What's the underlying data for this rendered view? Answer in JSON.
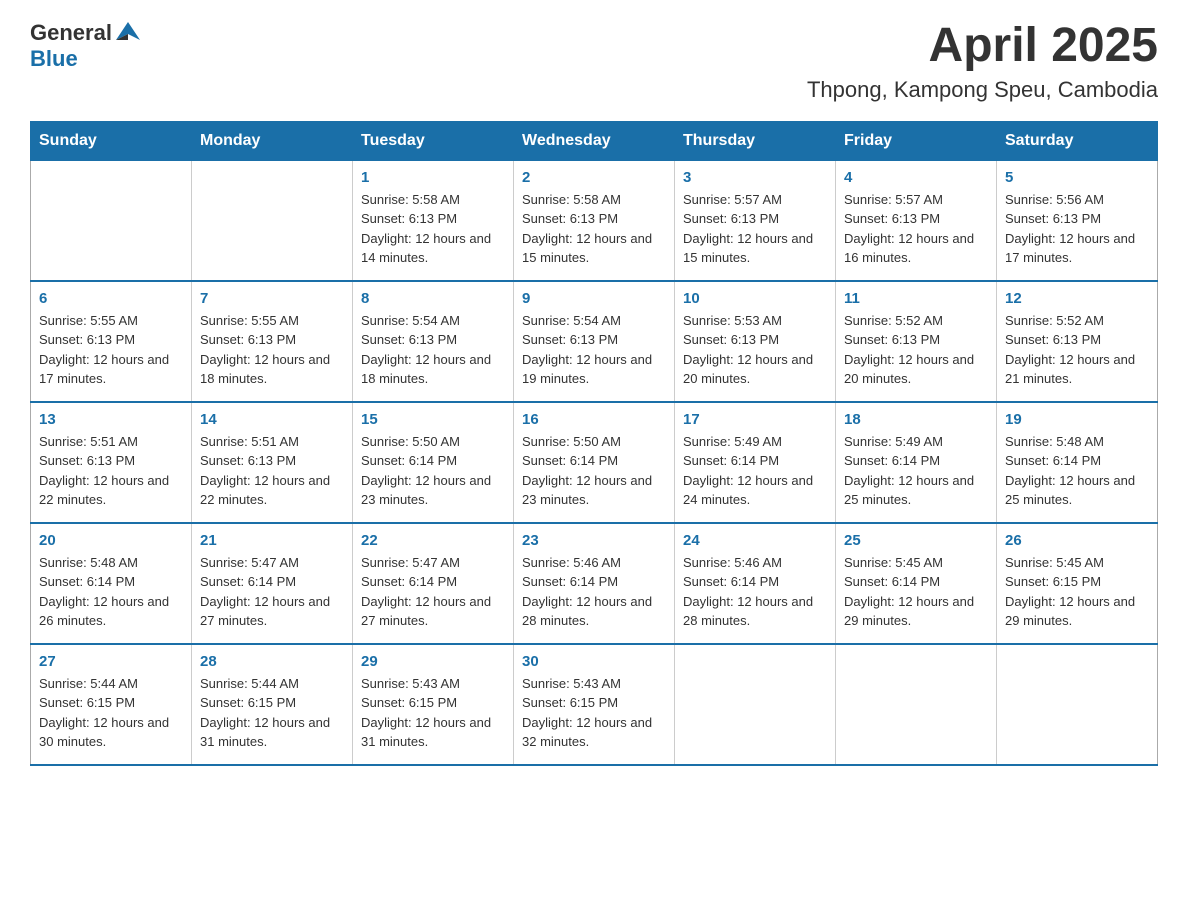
{
  "header": {
    "logo_general": "General",
    "logo_blue": "Blue",
    "title": "April 2025",
    "subtitle": "Thpong, Kampong Speu, Cambodia"
  },
  "calendar": {
    "days_of_week": [
      "Sunday",
      "Monday",
      "Tuesday",
      "Wednesday",
      "Thursday",
      "Friday",
      "Saturday"
    ],
    "weeks": [
      [
        {
          "day": "",
          "sunrise": "",
          "sunset": "",
          "daylight": ""
        },
        {
          "day": "",
          "sunrise": "",
          "sunset": "",
          "daylight": ""
        },
        {
          "day": "1",
          "sunrise": "Sunrise: 5:58 AM",
          "sunset": "Sunset: 6:13 PM",
          "daylight": "Daylight: 12 hours and 14 minutes."
        },
        {
          "day": "2",
          "sunrise": "Sunrise: 5:58 AM",
          "sunset": "Sunset: 6:13 PM",
          "daylight": "Daylight: 12 hours and 15 minutes."
        },
        {
          "day": "3",
          "sunrise": "Sunrise: 5:57 AM",
          "sunset": "Sunset: 6:13 PM",
          "daylight": "Daylight: 12 hours and 15 minutes."
        },
        {
          "day": "4",
          "sunrise": "Sunrise: 5:57 AM",
          "sunset": "Sunset: 6:13 PM",
          "daylight": "Daylight: 12 hours and 16 minutes."
        },
        {
          "day": "5",
          "sunrise": "Sunrise: 5:56 AM",
          "sunset": "Sunset: 6:13 PM",
          "daylight": "Daylight: 12 hours and 17 minutes."
        }
      ],
      [
        {
          "day": "6",
          "sunrise": "Sunrise: 5:55 AM",
          "sunset": "Sunset: 6:13 PM",
          "daylight": "Daylight: 12 hours and 17 minutes."
        },
        {
          "day": "7",
          "sunrise": "Sunrise: 5:55 AM",
          "sunset": "Sunset: 6:13 PM",
          "daylight": "Daylight: 12 hours and 18 minutes."
        },
        {
          "day": "8",
          "sunrise": "Sunrise: 5:54 AM",
          "sunset": "Sunset: 6:13 PM",
          "daylight": "Daylight: 12 hours and 18 minutes."
        },
        {
          "day": "9",
          "sunrise": "Sunrise: 5:54 AM",
          "sunset": "Sunset: 6:13 PM",
          "daylight": "Daylight: 12 hours and 19 minutes."
        },
        {
          "day": "10",
          "sunrise": "Sunrise: 5:53 AM",
          "sunset": "Sunset: 6:13 PM",
          "daylight": "Daylight: 12 hours and 20 minutes."
        },
        {
          "day": "11",
          "sunrise": "Sunrise: 5:52 AM",
          "sunset": "Sunset: 6:13 PM",
          "daylight": "Daylight: 12 hours and 20 minutes."
        },
        {
          "day": "12",
          "sunrise": "Sunrise: 5:52 AM",
          "sunset": "Sunset: 6:13 PM",
          "daylight": "Daylight: 12 hours and 21 minutes."
        }
      ],
      [
        {
          "day": "13",
          "sunrise": "Sunrise: 5:51 AM",
          "sunset": "Sunset: 6:13 PM",
          "daylight": "Daylight: 12 hours and 22 minutes."
        },
        {
          "day": "14",
          "sunrise": "Sunrise: 5:51 AM",
          "sunset": "Sunset: 6:13 PM",
          "daylight": "Daylight: 12 hours and 22 minutes."
        },
        {
          "day": "15",
          "sunrise": "Sunrise: 5:50 AM",
          "sunset": "Sunset: 6:14 PM",
          "daylight": "Daylight: 12 hours and 23 minutes."
        },
        {
          "day": "16",
          "sunrise": "Sunrise: 5:50 AM",
          "sunset": "Sunset: 6:14 PM",
          "daylight": "Daylight: 12 hours and 23 minutes."
        },
        {
          "day": "17",
          "sunrise": "Sunrise: 5:49 AM",
          "sunset": "Sunset: 6:14 PM",
          "daylight": "Daylight: 12 hours and 24 minutes."
        },
        {
          "day": "18",
          "sunrise": "Sunrise: 5:49 AM",
          "sunset": "Sunset: 6:14 PM",
          "daylight": "Daylight: 12 hours and 25 minutes."
        },
        {
          "day": "19",
          "sunrise": "Sunrise: 5:48 AM",
          "sunset": "Sunset: 6:14 PM",
          "daylight": "Daylight: 12 hours and 25 minutes."
        }
      ],
      [
        {
          "day": "20",
          "sunrise": "Sunrise: 5:48 AM",
          "sunset": "Sunset: 6:14 PM",
          "daylight": "Daylight: 12 hours and 26 minutes."
        },
        {
          "day": "21",
          "sunrise": "Sunrise: 5:47 AM",
          "sunset": "Sunset: 6:14 PM",
          "daylight": "Daylight: 12 hours and 27 minutes."
        },
        {
          "day": "22",
          "sunrise": "Sunrise: 5:47 AM",
          "sunset": "Sunset: 6:14 PM",
          "daylight": "Daylight: 12 hours and 27 minutes."
        },
        {
          "day": "23",
          "sunrise": "Sunrise: 5:46 AM",
          "sunset": "Sunset: 6:14 PM",
          "daylight": "Daylight: 12 hours and 28 minutes."
        },
        {
          "day": "24",
          "sunrise": "Sunrise: 5:46 AM",
          "sunset": "Sunset: 6:14 PM",
          "daylight": "Daylight: 12 hours and 28 minutes."
        },
        {
          "day": "25",
          "sunrise": "Sunrise: 5:45 AM",
          "sunset": "Sunset: 6:14 PM",
          "daylight": "Daylight: 12 hours and 29 minutes."
        },
        {
          "day": "26",
          "sunrise": "Sunrise: 5:45 AM",
          "sunset": "Sunset: 6:15 PM",
          "daylight": "Daylight: 12 hours and 29 minutes."
        }
      ],
      [
        {
          "day": "27",
          "sunrise": "Sunrise: 5:44 AM",
          "sunset": "Sunset: 6:15 PM",
          "daylight": "Daylight: 12 hours and 30 minutes."
        },
        {
          "day": "28",
          "sunrise": "Sunrise: 5:44 AM",
          "sunset": "Sunset: 6:15 PM",
          "daylight": "Daylight: 12 hours and 31 minutes."
        },
        {
          "day": "29",
          "sunrise": "Sunrise: 5:43 AM",
          "sunset": "Sunset: 6:15 PM",
          "daylight": "Daylight: 12 hours and 31 minutes."
        },
        {
          "day": "30",
          "sunrise": "Sunrise: 5:43 AM",
          "sunset": "Sunset: 6:15 PM",
          "daylight": "Daylight: 12 hours and 32 minutes."
        },
        {
          "day": "",
          "sunrise": "",
          "sunset": "",
          "daylight": ""
        },
        {
          "day": "",
          "sunrise": "",
          "sunset": "",
          "daylight": ""
        },
        {
          "day": "",
          "sunrise": "",
          "sunset": "",
          "daylight": ""
        }
      ]
    ]
  }
}
